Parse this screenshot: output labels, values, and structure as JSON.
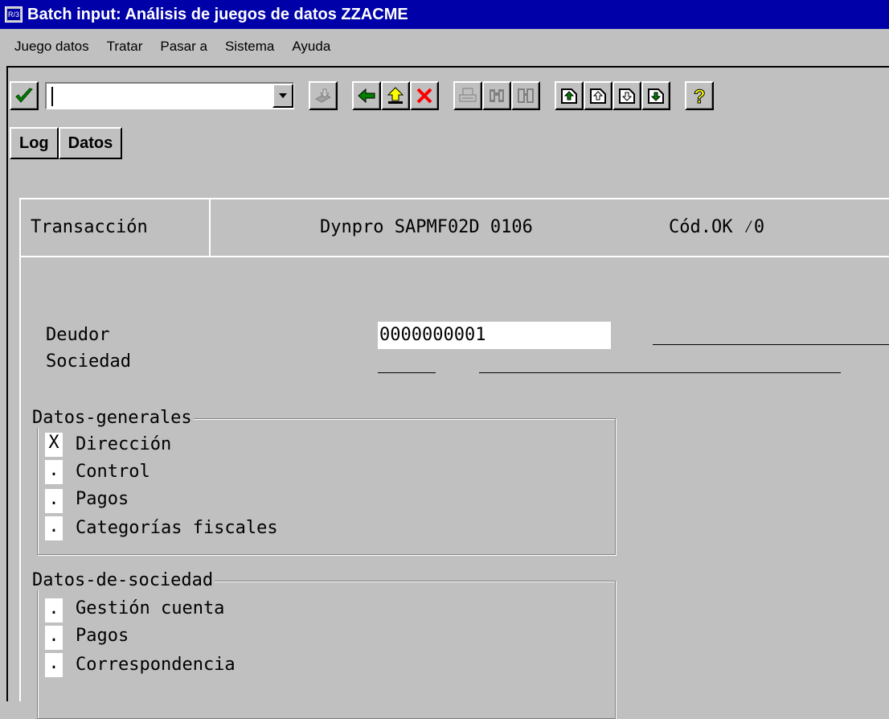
{
  "window": {
    "title": "Batch input: Análisis de juegos de datos ZZACME"
  },
  "menu": [
    "Juego datos",
    "Tratar",
    "Pasar a",
    "Sistema",
    "Ayuda"
  ],
  "command_field": {
    "value": ""
  },
  "tabs": {
    "log": "Log",
    "datos": "Datos"
  },
  "header": {
    "transaccion": "Transacción",
    "dynpro": "Dynpro SAPMF02D 0106",
    "codok": "Cód.OK  ⁄0"
  },
  "form": {
    "deudor_label": "Deudor",
    "deudor_value": "0000000001",
    "sociedad_label": "Sociedad"
  },
  "datos_generales": {
    "title": "Datos-generales",
    "items": [
      {
        "mark": "X",
        "label": "Dirección"
      },
      {
        "mark": ".",
        "label": "Control"
      },
      {
        "mark": ".",
        "label": "Pagos"
      },
      {
        "mark": ".",
        "label": "Categorías fiscales"
      }
    ]
  },
  "datos_sociedad": {
    "title": "Datos-de-sociedad",
    "items": [
      {
        "mark": ".",
        "label": "Gestión cuenta"
      },
      {
        "mark": ".",
        "label": "Pagos"
      },
      {
        "mark": ".",
        "label": "Correspondencia"
      }
    ]
  },
  "icons": [
    "check-icon",
    "dropdown-arrow-icon",
    "save-icon",
    "back-icon",
    "exit-icon",
    "cancel-icon",
    "print-icon",
    "find-icon",
    "find-next-icon",
    "first-page-icon",
    "previous-page-icon",
    "next-page-icon",
    "last-page-icon",
    "help-icon"
  ],
  "colors": {
    "titlebar": "#0000a8",
    "background": "#c0c0c0",
    "check": "#008000",
    "back_arrow": "#008000",
    "cancel": "#ff0000",
    "help": "#ffff00"
  }
}
